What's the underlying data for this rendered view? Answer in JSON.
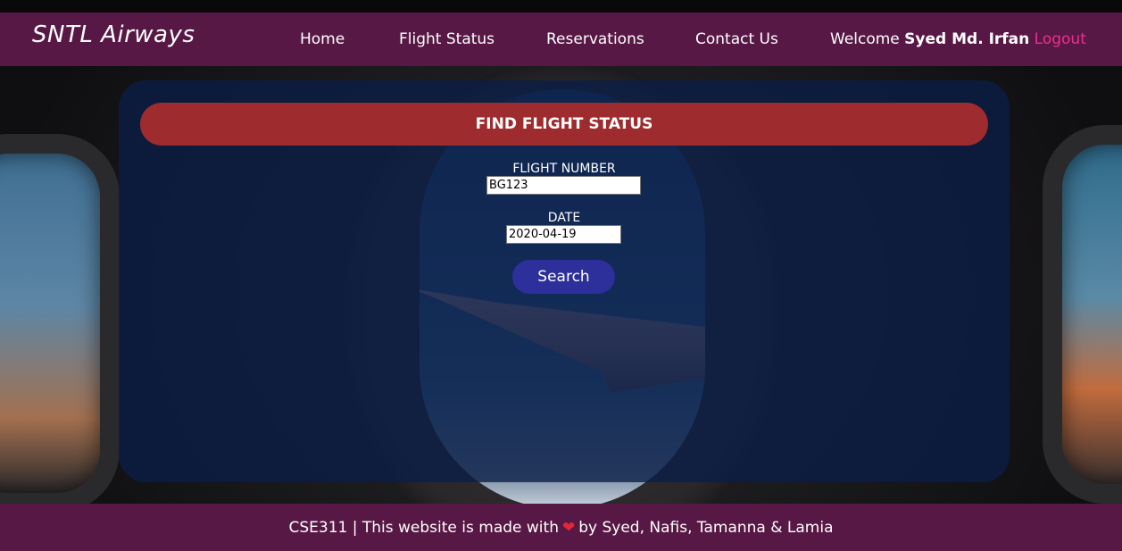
{
  "header": {
    "logo": "SNTL Airways",
    "nav": [
      "Home",
      "Flight Status",
      "Reservations",
      "Contact Us"
    ],
    "welcome_prefix": "Welcome",
    "user_name": "Syed Md. Irfan",
    "logout_label": "Logout"
  },
  "form": {
    "title": "FIND FLIGHT STATUS",
    "flight_number_label": "FLIGHT NUMBER",
    "flight_number_value": "BG123",
    "date_label": "DATE",
    "date_value": "2020-04-19",
    "search_label": "Search"
  },
  "footer": {
    "text_before": "CSE311 | This website is made with",
    "heart_icon": "heart-icon",
    "text_after": "by Syed, Nafis, Tamanna & Lamia"
  },
  "colors": {
    "header_bg": "#581845",
    "title_bar": "#9e2b2d",
    "search_button": "#2d2f9b",
    "logout_link": "#e8318e"
  }
}
